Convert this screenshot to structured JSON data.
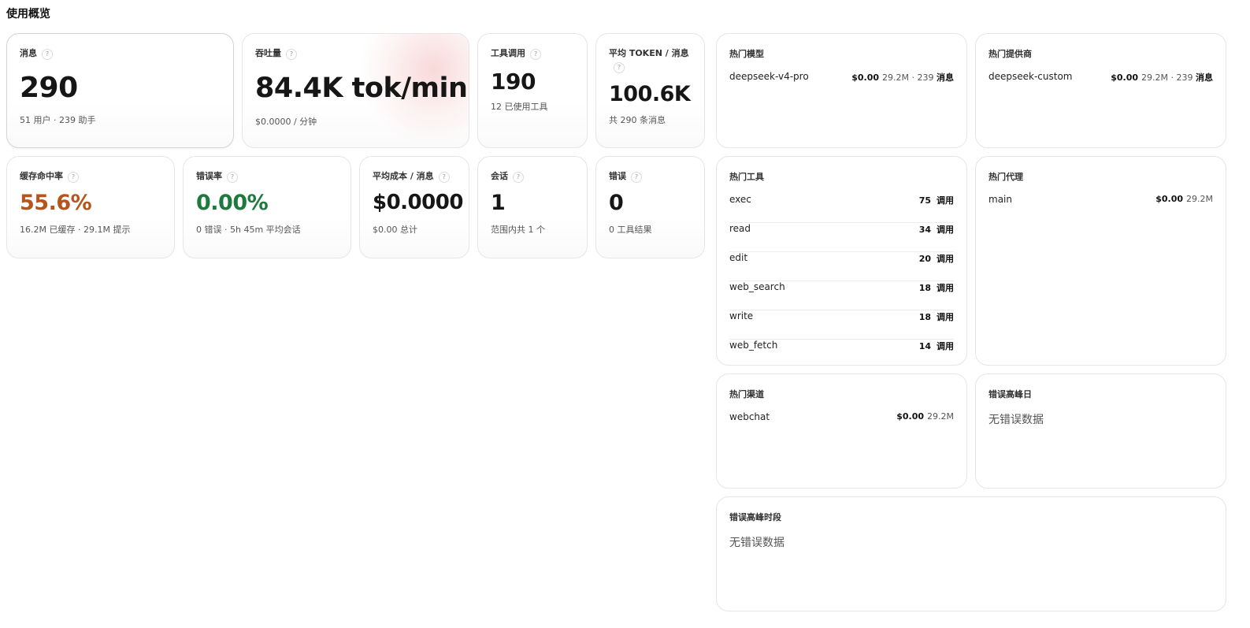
{
  "page_title": "使用概览",
  "stats": {
    "messages": {
      "label": "消息",
      "help": "?",
      "value": "290",
      "sub": "51 用户 · 239 助手"
    },
    "throughput": {
      "label": "吞吐量",
      "help": "?",
      "value": "84.4K tok/min",
      "sub": "$0.0000 / 分钟"
    },
    "tool_calls": {
      "label": "工具调用",
      "help": "?",
      "value": "190",
      "sub": "12 已使用工具"
    },
    "avg_tokens": {
      "label": "平均 TOKEN / 消息",
      "help": "?",
      "value": "100.6K",
      "sub": "共 290 条消息"
    },
    "cache_hit": {
      "label": "缓存命中率",
      "help": "?",
      "value": "55.6%",
      "sub": "16.2M 已缓存 · 29.1M 提示",
      "color": "#b5541c"
    },
    "error_rate": {
      "label": "错误率",
      "help": "?",
      "value": "0.00%",
      "sub": "0 错误 · 5h 45m 平均会话",
      "color": "#1e7a3c"
    },
    "avg_cost": {
      "label": "平均成本 / 消息",
      "help": "?",
      "value": "$0.0000",
      "sub": "$0.00 总计"
    },
    "sessions": {
      "label": "会话",
      "help": "?",
      "value": "1",
      "sub": "范围内共 1 个"
    },
    "errors": {
      "label": "错误",
      "help": "?",
      "value": "0",
      "sub": "0 工具结果"
    }
  },
  "top_models": {
    "title": "热门模型",
    "items": [
      {
        "name": "deepseek-v4-pro",
        "cost": "$0.00",
        "meta": "29.2M · 239",
        "unit": "消息"
      }
    ]
  },
  "top_providers": {
    "title": "热门提供商",
    "items": [
      {
        "name": "deepseek-custom",
        "cost": "$0.00",
        "meta": "29.2M · 239",
        "unit": "消息"
      }
    ]
  },
  "top_tools": {
    "title": "热门工具",
    "unit": "调用",
    "items": [
      {
        "name": "exec",
        "count": "75"
      },
      {
        "name": "read",
        "count": "34"
      },
      {
        "name": "edit",
        "count": "20"
      },
      {
        "name": "web_search",
        "count": "18"
      },
      {
        "name": "write",
        "count": "18"
      },
      {
        "name": "web_fetch",
        "count": "14"
      }
    ]
  },
  "top_agents": {
    "title": "热门代理",
    "items": [
      {
        "name": "main",
        "cost": "$0.00",
        "meta": "29.2M"
      }
    ]
  },
  "top_channels": {
    "title": "热门渠道",
    "items": [
      {
        "name": "webchat",
        "cost": "$0.00",
        "meta": "29.2M"
      }
    ]
  },
  "error_peak_day": {
    "title": "错误高峰日",
    "empty": "无错误数据"
  },
  "error_peak_hour": {
    "title": "错误高峰时段",
    "empty": "无错误数据"
  }
}
